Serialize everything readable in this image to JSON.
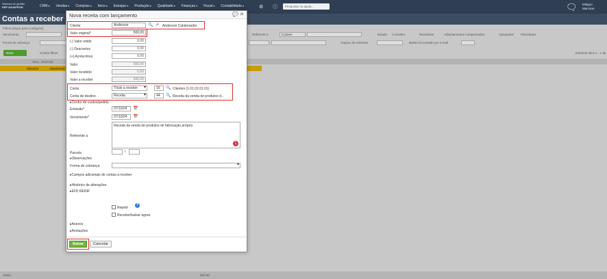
{
  "topbar": {
    "logo_line1": "Sistema de gestão",
    "logo_line2": "ERP MAXIPROD",
    "nav": [
      "CRM",
      "Vendas",
      "Compras",
      "Itens",
      "Estoque",
      "Produção",
      "Qualidade",
      "Finanças",
      "Fiscal",
      "Contabilidade"
    ],
    "search_placeholder": "Pesquisar na ajuda...",
    "user_line1": "Milagro",
    "user_line2": "Marcone"
  },
  "page": {
    "title": "Contas a receber"
  },
  "background": {
    "filters_label": "Filtros [clique para configurar]",
    "vencimento_label": "Vencimento",
    "forma_cobranca_label": "Forma de cobrança",
    "referente_label": "Referente a",
    "referente_op": "Contem",
    "estado_label": "Estado",
    "estado_options": [
      "A receber",
      "Recebidos",
      "Adiantamentos compensados",
      "Agrupados",
      "Parcelados"
    ],
    "arquivo_remessa_label": "Arquivo de remessa",
    "boleto_label": "Boleto foi enviado por e-mail",
    "novo_button": "Novo",
    "ocultar_filtros": "Ocultar filtros",
    "exibindo": "Exibindo itens 1 - 1 de",
    "col_venc": "Venc.",
    "col_desc": "Descriçã",
    "row_date": "09/10/24",
    "row_desc": "ANDERSO",
    "totais_label": "Totais:",
    "totais_value": "500,00"
  },
  "modal": {
    "title": "Nova receita com lançamento",
    "cliente_label": "Cliente",
    "cliente_value": "Anderson",
    "cliente_link": "Anderson Colaborador",
    "valor_original_label": "Valor original*",
    "valor_original": "500,00",
    "valor_retido_label": "(-) Valor retido",
    "valor_retido": "0,00",
    "descontos_label": "(-) Descontos",
    "descontos": "0,00",
    "acrescimos_label": "(+) Acréscimos",
    "acrescimos": "0,00",
    "valor_label": "Valor",
    "valor": "500,00",
    "valor_recebido_label": "Valor recebido",
    "valor_recebido": "0,00",
    "valor_receber_label": "Valor a receber",
    "valor_receber": "500,00",
    "conta_label": "Conta",
    "conta_type": "Título a receber",
    "conta_code": "16",
    "conta_desc": "Clientes (1.01.02.01.01)",
    "conta_destino_label": "Conta de destino",
    "conta_destino_type": "Receita",
    "conta_destino_code": "44",
    "conta_destino_desc": "Receita da venda de produtos d...",
    "centro_custos": "Centro de custos/pedido",
    "emissao_label": "Emissão*",
    "emissao": "07/10/24",
    "vencimento_label": "Vencimento*",
    "vencimento": "07/10/24",
    "referente_label": "Referente a",
    "referente_value": "Receita da venda de produtos de fabricação própria",
    "parcela_label": "Parcela",
    "parcela_sep": "/",
    "observacoes": "Observações",
    "forma_cobranca_label": "Forma de cobrança",
    "campos_adicionais": "Campos adicionais de contas a receber",
    "historico": "Histórico de alterações",
    "efd_reinf": "EFD REINF",
    "repetir_label": "Repetir",
    "receber_agora_label": "Receber/baixar agora",
    "anexos": "Anexos",
    "anotacoes": "Anotações",
    "save_label": "Salvar",
    "cancel_label": "Cancelar"
  }
}
